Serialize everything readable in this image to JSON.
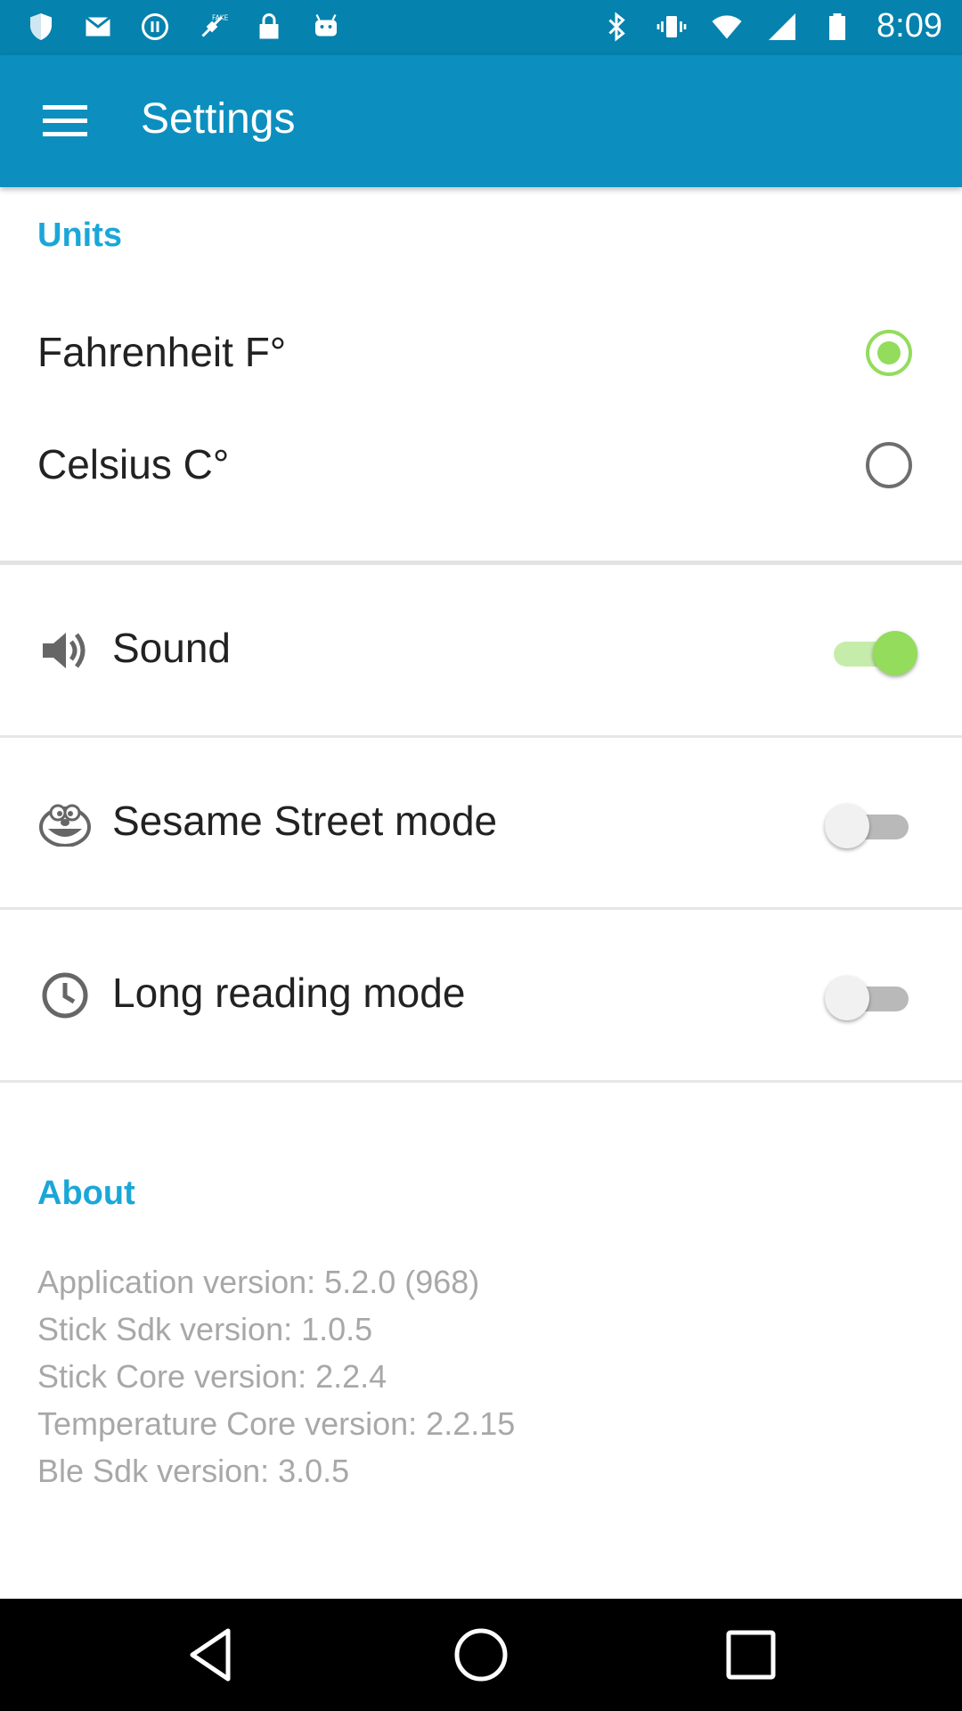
{
  "status_bar": {
    "time": "8:09",
    "left_icons": [
      "shield-icon",
      "mail-icon",
      "pause-circle-icon",
      "fake-gps-icon",
      "lock-icon",
      "android-icon"
    ],
    "right_icons": [
      "bluetooth-icon",
      "vibrate-icon",
      "wifi-icon",
      "signal-icon",
      "battery-icon"
    ]
  },
  "app_bar": {
    "menu_icon": "menu-icon",
    "title": "Settings"
  },
  "units": {
    "header": "Units",
    "options": [
      {
        "label": "Fahrenheit F°",
        "selected": true
      },
      {
        "label": "Celsius C°",
        "selected": false
      }
    ]
  },
  "toggles": [
    {
      "icon": "speaker-icon",
      "label": "Sound",
      "on": true
    },
    {
      "icon": "elmo-face-icon",
      "label": "Sesame Street mode",
      "on": false
    },
    {
      "icon": "clock-icon",
      "label": "Long reading mode",
      "on": false
    }
  ],
  "about": {
    "header": "About",
    "lines": [
      "Application version: 5.2.0 (968)",
      "Stick Sdk version: 1.0.5",
      "Stick Core version: 2.2.4",
      "Temperature Core version: 2.2.15",
      "Ble Sdk version: 3.0.5"
    ]
  },
  "nav_bar": {
    "buttons": [
      "back-icon",
      "home-icon",
      "recents-icon"
    ]
  },
  "colors": {
    "status_bar": "#0582ad",
    "app_bar": "#0c8fbf",
    "section_header": "#1aa7d8",
    "accent_green": "#93dc5c"
  }
}
